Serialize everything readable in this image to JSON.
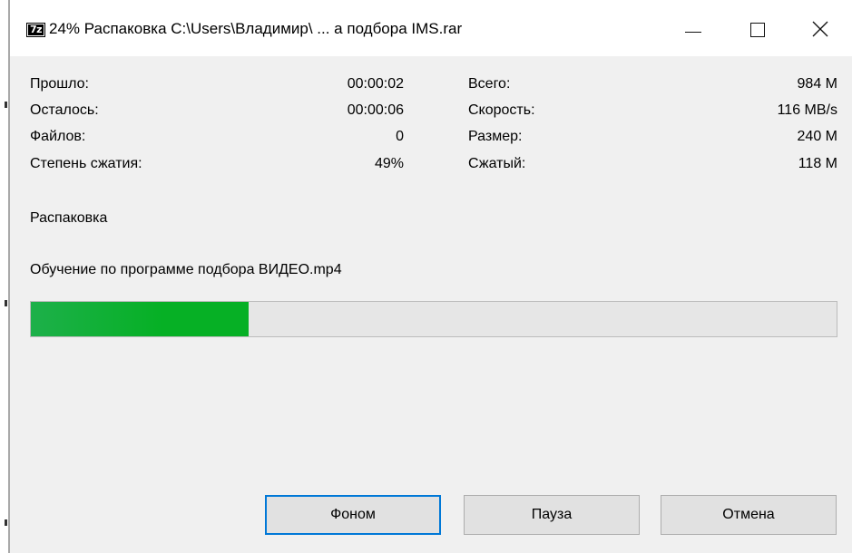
{
  "window": {
    "title": "24% Распаковка C:\\Users\\Владимир\\ ... а подбора  IMS.rar",
    "app_icon_text": "7z",
    "progress_fraction": 0.27
  },
  "stats": {
    "elapsed_label": "Прошло:",
    "elapsed_value": "00:00:02",
    "remaining_label": "Осталось:",
    "remaining_value": "00:00:06",
    "files_label": "Файлов:",
    "files_value": "0",
    "ratio_label": "Степень сжатия:",
    "ratio_value": "49%",
    "total_label": "Всего:",
    "total_value": "984 M",
    "speed_label": "Скорость:",
    "speed_value": "116 MB/s",
    "size_label": "Размер:",
    "size_value": "240 M",
    "packed_label": "Сжатый:",
    "packed_value": "118 M"
  },
  "operation": "Распаковка",
  "current_file": "Обучение по программе подбора ВИДЕО.mp4",
  "buttons": {
    "background": "Фоном",
    "pause": "Пауза",
    "cancel": "Отмена"
  },
  "colors": {
    "progress_fill": "#06b025",
    "default_button_border": "#0078d7"
  }
}
